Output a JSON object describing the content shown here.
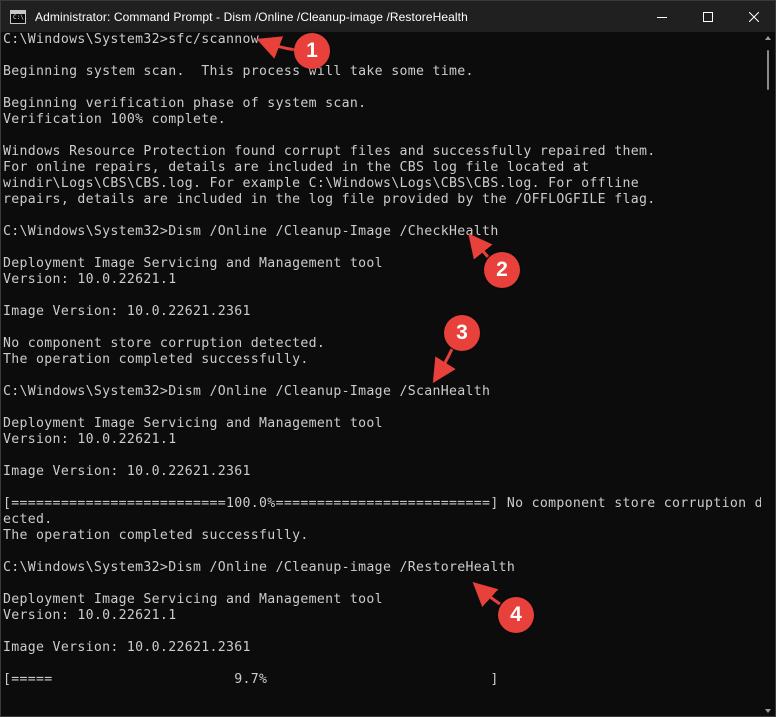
{
  "window": {
    "title": "Administrator: Command Prompt - Dism  /Online /Cleanup-image /RestoreHealth",
    "app_icon_text": "C:\\."
  },
  "console": {
    "lines": [
      "C:\\Windows\\System32>sfc/scannow",
      "",
      "Beginning system scan.  This process will take some time.",
      "",
      "Beginning verification phase of system scan.",
      "Verification 100% complete.",
      "",
      "Windows Resource Protection found corrupt files and successfully repaired them.",
      "For online repairs, details are included in the CBS log file located at",
      "windir\\Logs\\CBS\\CBS.log. For example C:\\Windows\\Logs\\CBS\\CBS.log. For offline",
      "repairs, details are included in the log file provided by the /OFFLOGFILE flag.",
      "",
      "C:\\Windows\\System32>Dism /Online /Cleanup-Image /CheckHealth",
      "",
      "Deployment Image Servicing and Management tool",
      "Version: 10.0.22621.1",
      "",
      "Image Version: 10.0.22621.2361",
      "",
      "No component store corruption detected.",
      "The operation completed successfully.",
      "",
      "C:\\Windows\\System32>Dism /Online /Cleanup-Image /ScanHealth",
      "",
      "Deployment Image Servicing and Management tool",
      "Version: 10.0.22621.1",
      "",
      "Image Version: 10.0.22621.2361",
      "",
      "[==========================100.0%==========================] No component store corruption det",
      "ected.",
      "The operation completed successfully.",
      "",
      "C:\\Windows\\System32>Dism /Online /Cleanup-image /RestoreHealth",
      "",
      "Deployment Image Servicing and Management tool",
      "Version: 10.0.22621.1",
      "",
      "Image Version: 10.0.22621.2361",
      "",
      "[=====                      9.7%                           ]"
    ]
  },
  "annotations": {
    "badges": [
      "1",
      "2",
      "3",
      "4"
    ],
    "color": "#e8403a"
  }
}
